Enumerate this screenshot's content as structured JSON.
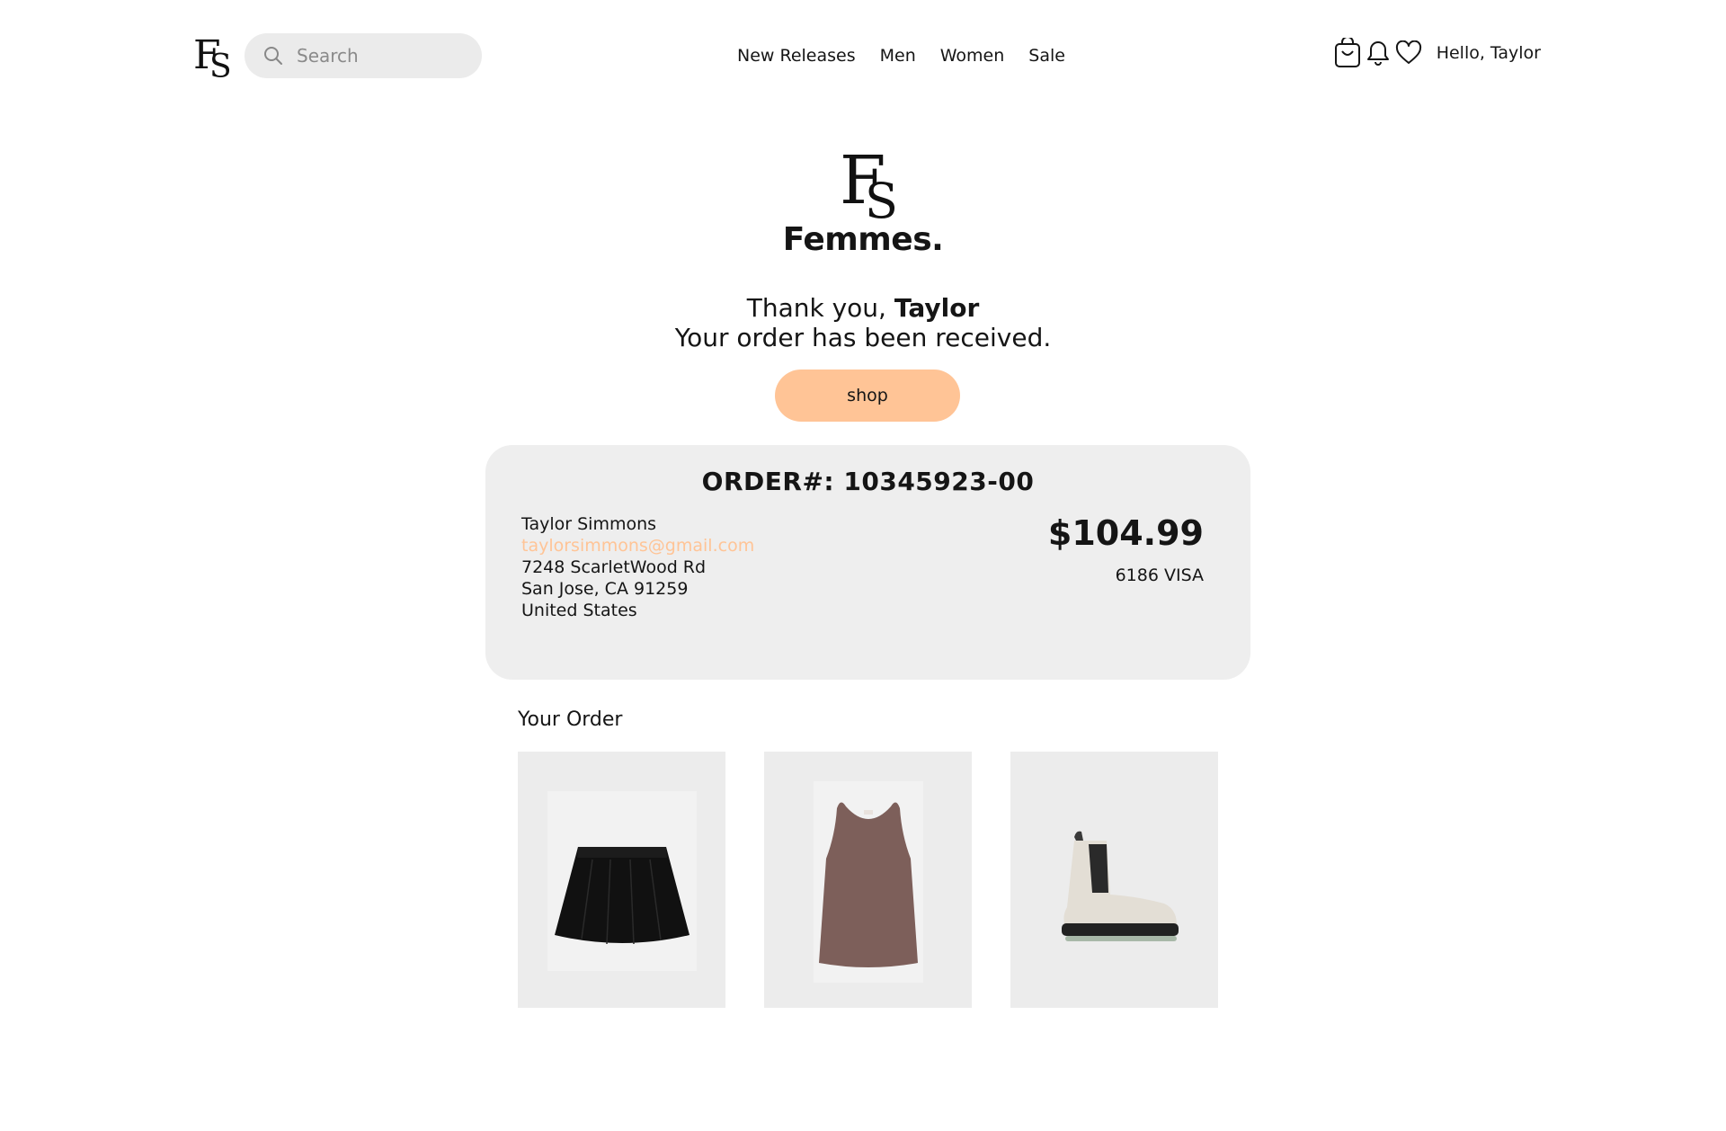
{
  "header": {
    "search_placeholder": "Search",
    "nav": [
      "New Releases",
      "Men",
      "Women",
      "Sale"
    ],
    "greeting": "Hello, Taylor"
  },
  "brand": {
    "logo_letters": "FS",
    "name": "Femmes."
  },
  "confirmation": {
    "thanks_prefix": "Thank you, ",
    "customer_first_name": "Taylor",
    "message": "Your order has been received.",
    "shop_button": "shop"
  },
  "order": {
    "number_label": "ORDER#: 10345923-00",
    "customer": {
      "name": "Taylor Simmons",
      "email": "taylorsimmons@gmail.com",
      "street": "7248 ScarletWood Rd",
      "city_line": "San Jose, CA 91259",
      "country": "United States"
    },
    "total": "$104.99",
    "payment": "6186 VISA"
  },
  "your_order": {
    "title": "Your Order",
    "items": [
      {
        "icon": "black-pleated-skirt"
      },
      {
        "icon": "brown-tank-top"
      },
      {
        "icon": "cream-chelsea-boot"
      }
    ]
  },
  "colors": {
    "accent": "#ffc496",
    "card_bg": "#eeeeee",
    "text": "#151515"
  }
}
